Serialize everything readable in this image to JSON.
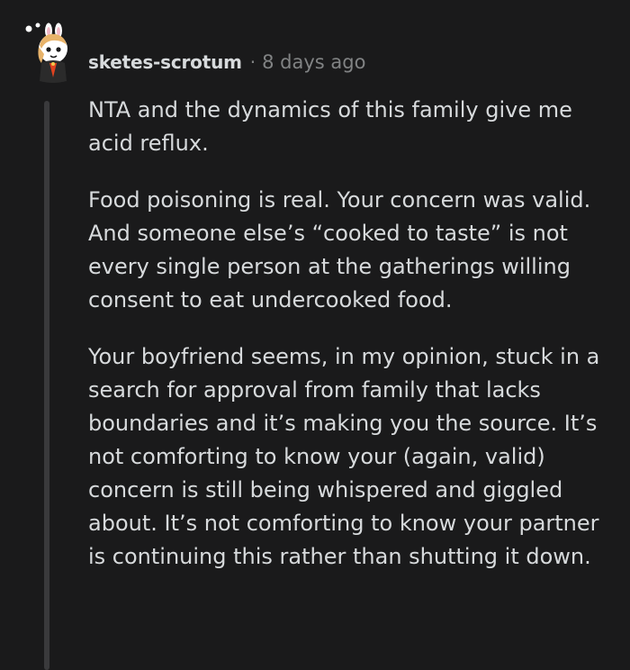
{
  "comment": {
    "author": "sketes-scrotum",
    "separator": "·",
    "timestamp": "8 days ago",
    "avatar_icon": "snoo-bunny-avatar-icon",
    "paragraphs": [
      "NTA and the dynamics of this family give me acid reflux.",
      "Food poisoning is real. Your concern was valid. And someone else’s “cooked to taste” is not every single person at the gatherings willing consent to eat undercooked food.",
      "Your boyfriend seems, in my opinion, stuck in a search for approval from family that lacks boundaries and it’s making you the source. It’s not comforting to know your (again, valid) concern is still being whispered and giggled about. It’s not comforting to know your partner is continuing this rather than shutting it down."
    ]
  },
  "colors": {
    "background": "#1a1a1b",
    "text": "#d7dadc",
    "muted": "#818384",
    "thread_line": "#3a3a3c"
  }
}
